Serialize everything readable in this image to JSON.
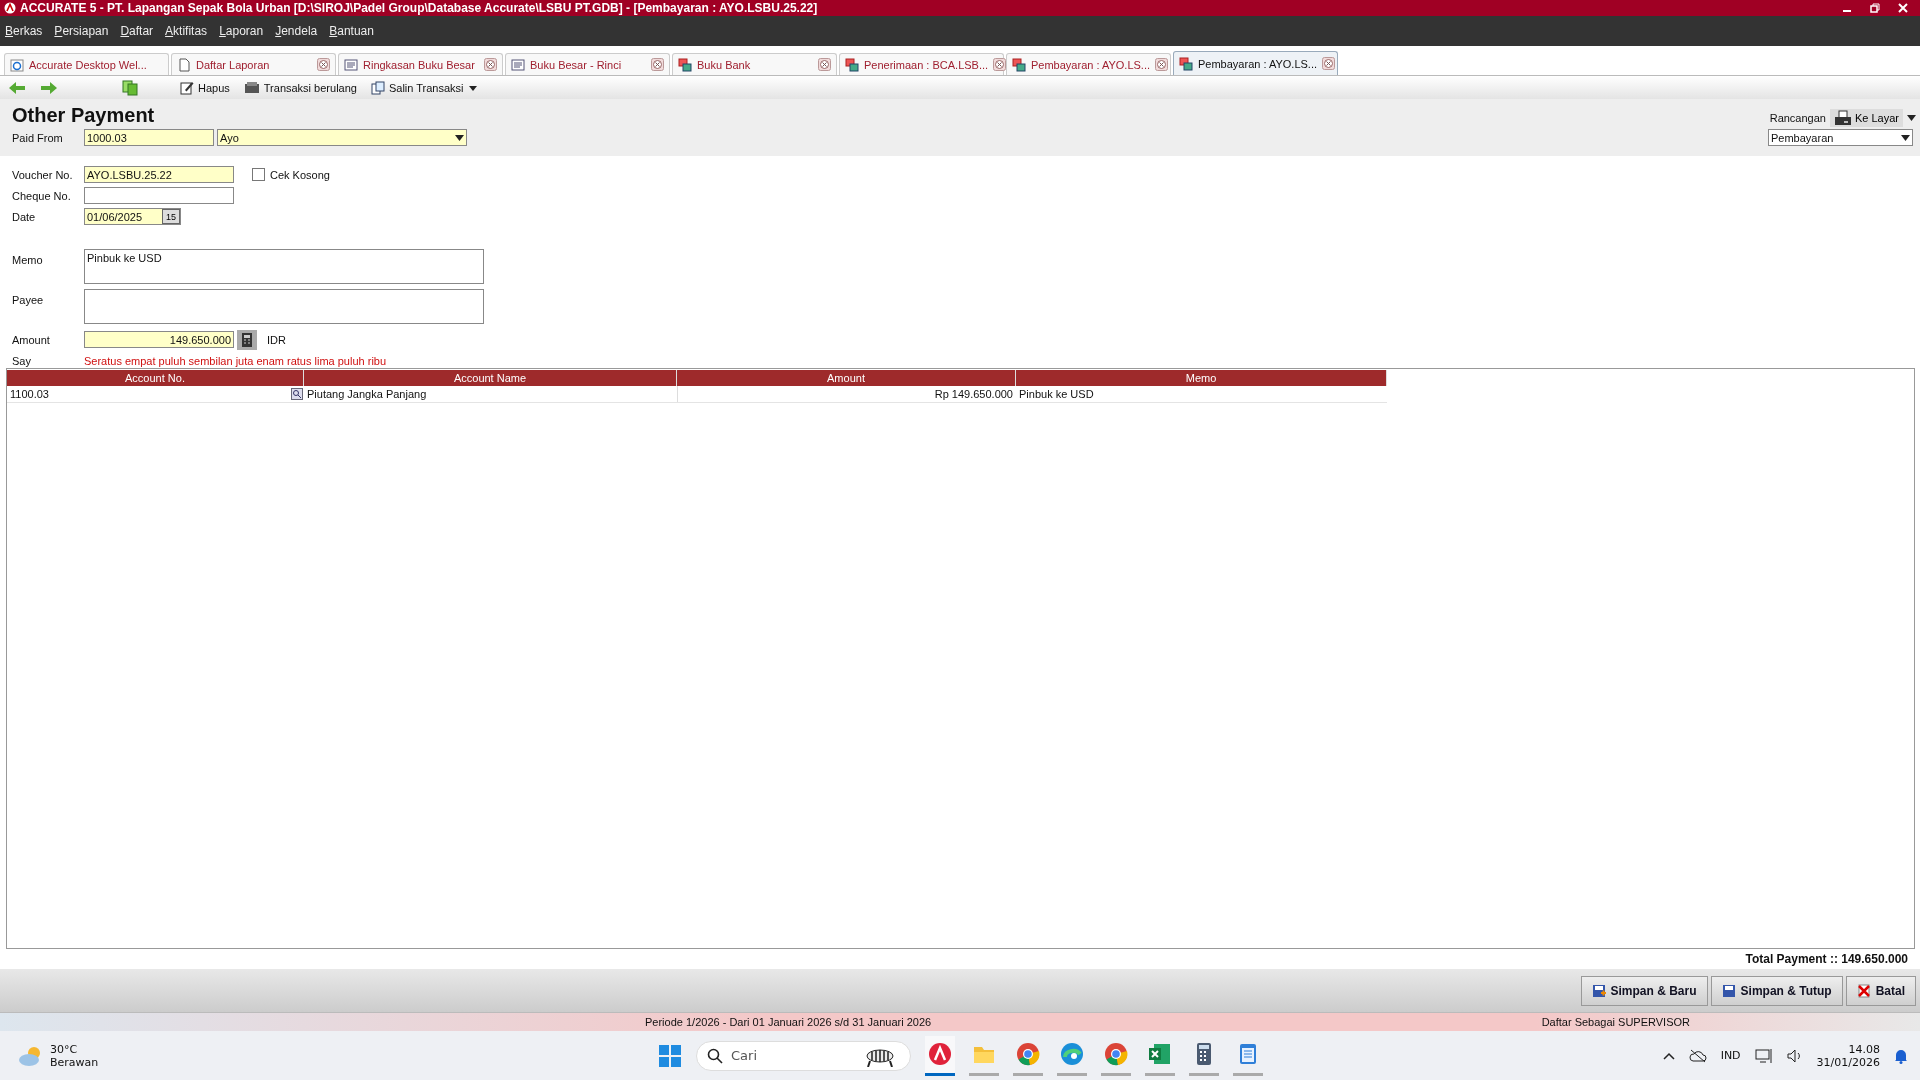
{
  "window": {
    "title": "ACCURATE 5  - PT. Lapangan Sepak Bola Urban   [D:\\SIROJ\\Padel Group\\Database Accurate\\LSBU PT.GDB] - [Pembayaran : AYO.LSBU.25.22]"
  },
  "menu": [
    "Berkas",
    "Persiapan",
    "Daftar",
    "Aktifitas",
    "Laporan",
    "Jendela",
    "Bantuan"
  ],
  "tabs": [
    {
      "label": "Accurate Desktop Wel...",
      "kind": "web",
      "selected": false,
      "closable": false
    },
    {
      "label": "Daftar Laporan",
      "kind": "page",
      "selected": false,
      "closable": true
    },
    {
      "label": "Ringkasan Buku Besar",
      "kind": "ledger",
      "selected": false,
      "closable": true
    },
    {
      "label": "Buku Besar - Rinci",
      "kind": "ledger",
      "selected": false,
      "closable": true
    },
    {
      "label": "Buku Bank",
      "kind": "form",
      "selected": false,
      "closable": true
    },
    {
      "label": "Penerimaan : BCA.LSB...",
      "kind": "form",
      "selected": false,
      "closable": true
    },
    {
      "label": "Pembayaran : AYO.LS...",
      "kind": "form",
      "selected": false,
      "closable": true
    },
    {
      "label": "Pembayaran : AYO.LS...",
      "kind": "form",
      "selected": true,
      "closable": true
    }
  ],
  "toolbar": [
    {
      "kind": "delete",
      "label": "Hapus"
    },
    {
      "kind": "recurring",
      "label": "Transaksi berulang"
    },
    {
      "kind": "copy",
      "label": "Salin Transaksi"
    }
  ],
  "form": {
    "title": "Other Payment",
    "paid_from": {
      "label": "Paid From",
      "code": "1000.03",
      "name": "Ayo"
    },
    "voucher_no": {
      "label": "Voucher No.",
      "value": "AYO.LSBU.25.22"
    },
    "cek_kosong": {
      "label": "Cek Kosong",
      "checked": false
    },
    "cheque_no": {
      "label": "Cheque No."
    },
    "date": {
      "label": "Date",
      "value": "01/06/2025",
      "button": "15"
    },
    "memo": {
      "label": "Memo",
      "value": "Pinbuk ke USD"
    },
    "payee": {
      "label": "Payee"
    },
    "amount": {
      "label": "Amount",
      "value": "149.650.000",
      "currency": "IDR"
    },
    "say": {
      "label": "Say",
      "text": "Seratus empat puluh sembilan juta enam ratus lima puluh ribu"
    }
  },
  "print": {
    "label": "Rancangan",
    "button": "Ke Layar",
    "template": "Pembayaran"
  },
  "table": {
    "columns": [
      "Account No.",
      "Account Name",
      "Amount",
      "Memo"
    ],
    "rows": [
      {
        "cells": [
          "1100.03",
          "Piutang Jangka Panjang",
          "Rp 149.650.000",
          "Pinbuk ke USD"
        ]
      }
    ]
  },
  "total": "Total Payment :: 149.650.000",
  "buttons": [
    {
      "kind": "save-new",
      "label": "Simpan & Baru"
    },
    {
      "kind": "save-close",
      "label": "Simpan & Tutup"
    },
    {
      "kind": "cancel",
      "label": "Batal"
    }
  ],
  "status_bar": {
    "period": "Periode 1/2026 - Dari 01 Januari 2026 s/d 31 Januari 2026",
    "user": "Daftar Sebagai SUPERVISOR"
  },
  "taskbar": {
    "temperature": "30°C",
    "weather": "Berawan",
    "search_placeholder": "Cari",
    "apps": [
      {
        "kind": "accurate",
        "selected": true
      },
      {
        "kind": "folder",
        "selected": false
      },
      {
        "kind": "chrome",
        "selected": false
      },
      {
        "kind": "edge",
        "selected": false
      },
      {
        "kind": "chrome",
        "selected": false
      },
      {
        "kind": "excel",
        "selected": false
      },
      {
        "kind": "calculator",
        "selected": false
      },
      {
        "kind": "notepad",
        "selected": false
      }
    ],
    "language": "IND",
    "time": "14.08",
    "date": "31/01/2026"
  }
}
